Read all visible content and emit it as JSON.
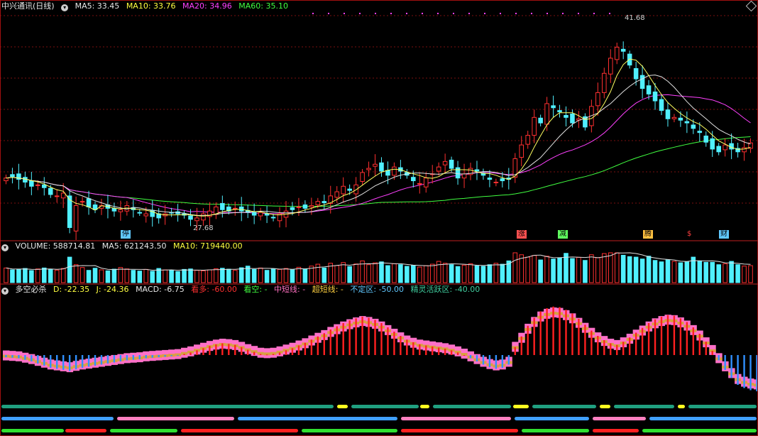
{
  "main": {
    "title": "中兴通讯(日线)",
    "ma5": "MA5: 33.45",
    "ma10": "MA10: 33.76",
    "ma20": "MA20: 34.96",
    "ma60": "MA60: 35.10",
    "high_label": "41.68",
    "low_label": "27.68",
    "event_tags": [
      "停",
      "涨",
      "减",
      "腾",
      "$",
      "财"
    ]
  },
  "volume": {
    "label": "VOLUME: 588714.81",
    "ma5": "MA5: 621243.50",
    "ma10": "MA10: 719440.00"
  },
  "indicator": {
    "name": "多空必杀",
    "d": "D: -22.35",
    "j": "J: -24.36",
    "macd": "MACD: -6.75",
    "kanduo": "看多: -60.00",
    "kankong": "看空: -",
    "zhongduan": "中短线: -",
    "chaoduan": "超短线: -",
    "buding": "不定区: -50.00",
    "jingling": "精灵活跃区: -40.00"
  },
  "colors": {
    "up": "#ff3030",
    "down": "#50f0ff",
    "ma5": "#ffff60",
    "ma10": "#e0e0e0",
    "ma20": "#ff40ff",
    "ma60": "#40ff40"
  },
  "chart_data": {
    "type": "candlestick",
    "price_ylim": [
      26.5,
      43
    ],
    "closes": [
      30.9,
      31.0,
      30.8,
      30.6,
      30.3,
      30.4,
      30.2,
      29.7,
      29.6,
      29.8,
      27.3,
      28.9,
      29.2,
      28.8,
      28.6,
      28.9,
      28.7,
      28.5,
      28.6,
      28.9,
      28.6,
      28.4,
      28.3,
      28.1,
      28.0,
      28.3,
      28.4,
      28.3,
      28.2,
      27.9,
      28.0,
      28.3,
      28.5,
      28.8,
      28.6,
      28.5,
      28.7,
      28.5,
      28.4,
      28.2,
      28.4,
      28.2,
      28.0,
      28.3,
      28.5,
      28.6,
      28.8,
      28.7,
      28.9,
      29.2,
      29.1,
      29.6,
      29.9,
      30.3,
      30.0,
      30.4,
      31.3,
      31.6,
      31.9,
      31.4,
      31.1,
      31.7,
      31.4,
      31.1,
      30.7,
      30.5,
      30.9,
      31.2,
      31.7,
      32.1,
      31.6,
      30.9,
      31.2,
      31.6,
      31.4,
      31.1,
      30.8,
      30.6,
      30.7,
      30.8,
      32.3,
      33.3,
      34.0,
      35.3,
      34.9,
      36.3,
      36.0,
      35.7,
      35.3,
      34.9,
      35.2,
      34.6,
      36.1,
      37.1,
      38.5,
      39.6,
      40.4,
      40.1,
      39.1,
      38.1,
      37.4,
      37.0,
      36.5,
      35.8,
      35.2,
      35.3,
      35.1,
      34.9,
      34.5,
      34.2,
      33.5,
      33.0,
      32.8,
      33.3,
      33.0,
      32.8,
      33.1,
      33.45
    ],
    "volume_ylim": [
      0,
      2400000
    ],
    "volume_values": [
      620000,
      540000,
      560000,
      600000,
      510000,
      580000,
      620000,
      570000,
      530000,
      600000,
      1080000,
      760000,
      640000,
      520000,
      610000,
      540000,
      500000,
      570000,
      640000,
      580000,
      520000,
      490000,
      560000,
      480000,
      600000,
      540000,
      520000,
      470000,
      560000,
      580000,
      520000,
      500000,
      540000,
      590000,
      610000,
      570000,
      520000,
      630000,
      700000,
      560000,
      620000,
      520000,
      590000,
      560000,
      600000,
      540000,
      650000,
      570000,
      700000,
      780000,
      620000,
      820000,
      720000,
      850000,
      680000,
      790000,
      920000,
      760000,
      840000,
      880000,
      720000,
      800000,
      760000,
      690000,
      730000,
      660000,
      720000,
      780000,
      900000,
      820000,
      760000,
      680000,
      740000,
      800000,
      710000,
      690000,
      760000,
      820000,
      780000,
      920000,
      1460000,
      1180000,
      1080000,
      1150000,
      960000,
      1120000,
      1000000,
      1050000,
      1240000,
      1020000,
      1070000,
      940000,
      1180000,
      1060000,
      1230000,
      1300000,
      1520000,
      1160000,
      1100000,
      1080000,
      1000000,
      1120000,
      940000,
      880000,
      960000,
      900000,
      840000,
      880000,
      1080000,
      920000,
      860000,
      860000,
      760000,
      800000,
      900000,
      760000,
      700000,
      720000
    ],
    "macd_values": [
      -0.4,
      -0.5,
      -0.6,
      -0.9,
      -1.2,
      -1.6,
      -2.0,
      -2.4,
      -2.6,
      -2.8,
      -3.0,
      -2.7,
      -2.4,
      -2.2,
      -2.0,
      -1.8,
      -1.6,
      -1.4,
      -1.2,
      -1.0,
      -0.9,
      -0.8,
      -0.6,
      -0.5,
      -0.4,
      -0.3,
      -0.2,
      -0.1,
      0.2,
      0.5,
      0.9,
      1.3,
      1.7,
      2.0,
      2.2,
      2.1,
      1.9,
      1.5,
      1.0,
      0.6,
      0.2,
      0.1,
      0.2,
      0.5,
      0.9,
      1.3,
      1.8,
      2.3,
      2.9,
      3.5,
      4.1,
      4.8,
      5.4,
      6.0,
      6.5,
      6.9,
      7.2,
      7.0,
      6.6,
      6.0,
      5.2,
      4.4,
      3.6,
      2.9,
      2.4,
      2.0,
      1.8,
      1.6,
      1.4,
      1.2,
      0.9,
      0.5,
      0.0,
      -0.6,
      -1.2,
      -1.8,
      -2.3,
      -2.6,
      -2.4,
      -1.8,
      1.5,
      3.5,
      5.5,
      7.0,
      8.2,
      8.8,
      9.1,
      9.0,
      8.5,
      7.8,
      6.8,
      5.7,
      4.6,
      3.6,
      2.8,
      2.2,
      1.9,
      2.5,
      3.3,
      4.2,
      5.1,
      6.0,
      6.7,
      7.2,
      7.5,
      7.4,
      6.9,
      6.2,
      5.2,
      4.0,
      2.5,
      0.8,
      -1.0,
      -2.8,
      -4.3,
      -5.6,
      -6.2,
      -6.6,
      -6.8,
      -6.75
    ],
    "series": [
      {
        "name": "MA5",
        "value": 33.45
      },
      {
        "name": "MA10",
        "value": 33.76
      },
      {
        "name": "MA20",
        "value": 34.96
      },
      {
        "name": "MA60",
        "value": 35.1
      }
    ]
  }
}
